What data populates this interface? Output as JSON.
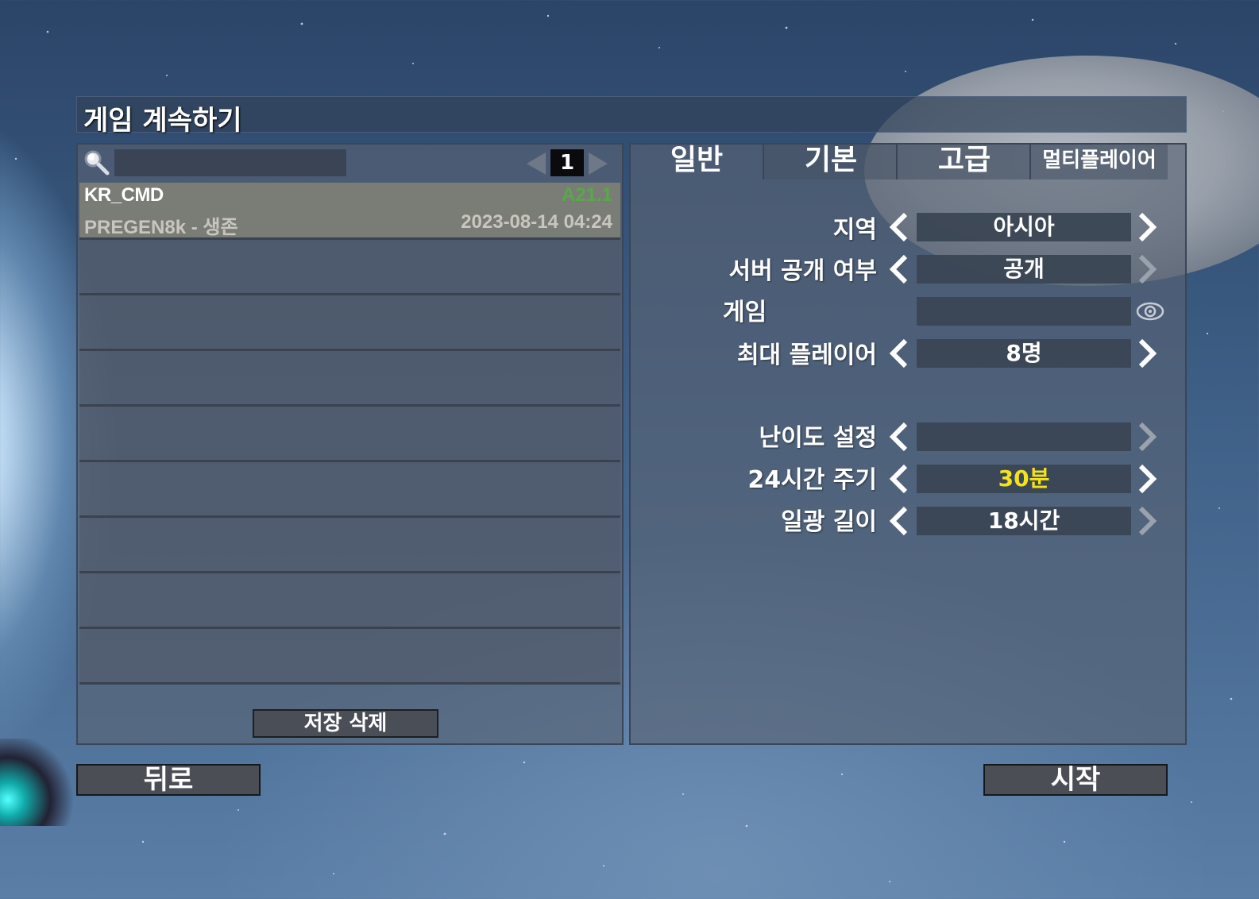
{
  "window": {
    "title": "게임 계속하기"
  },
  "search": {
    "placeholder": "",
    "value": ""
  },
  "pagination": {
    "current_page": "1"
  },
  "saves": [
    {
      "name": "KR_CMD",
      "version": "A21.1",
      "subtitle": "PREGEN8k - 생존",
      "date": "2023-08-14 04:24",
      "selected": true
    },
    {
      "name": "",
      "version": "",
      "subtitle": "",
      "date": "",
      "selected": false
    },
    {
      "name": "",
      "version": "",
      "subtitle": "",
      "date": "",
      "selected": false
    },
    {
      "name": "",
      "version": "",
      "subtitle": "",
      "date": "",
      "selected": false
    },
    {
      "name": "",
      "version": "",
      "subtitle": "",
      "date": "",
      "selected": false
    },
    {
      "name": "",
      "version": "",
      "subtitle": "",
      "date": "",
      "selected": false
    },
    {
      "name": "",
      "version": "",
      "subtitle": "",
      "date": "",
      "selected": false
    },
    {
      "name": "",
      "version": "",
      "subtitle": "",
      "date": "",
      "selected": false
    },
    {
      "name": "",
      "version": "",
      "subtitle": "",
      "date": "",
      "selected": false
    }
  ],
  "delete_button": {
    "label": "저장 삭제"
  },
  "tabs": [
    {
      "label": "일반",
      "active": true
    },
    {
      "label": "기본",
      "active": false
    },
    {
      "label": "고급",
      "active": false
    },
    {
      "label": "멀티플레이어",
      "active": false
    }
  ],
  "options": {
    "region": {
      "label": "지역",
      "value": "아시아"
    },
    "server_visibility": {
      "label": "서버 공개 여부",
      "value": "공개"
    },
    "game_password": {
      "label": "게임",
      "value": ""
    },
    "max_players": {
      "label": "최대 플레이어",
      "value": "8명"
    },
    "difficulty": {
      "label": "난이도 설정",
      "value": ""
    },
    "day_cycle": {
      "label": "24시간 주기",
      "value": "30분"
    },
    "daylight": {
      "label": "일광 길이",
      "value": "18시간"
    }
  },
  "colors": {
    "version_green": "#5aa74b",
    "highlight_yellow": "#f3e31b"
  },
  "buttons": {
    "back": "뒤로",
    "start": "시작"
  }
}
